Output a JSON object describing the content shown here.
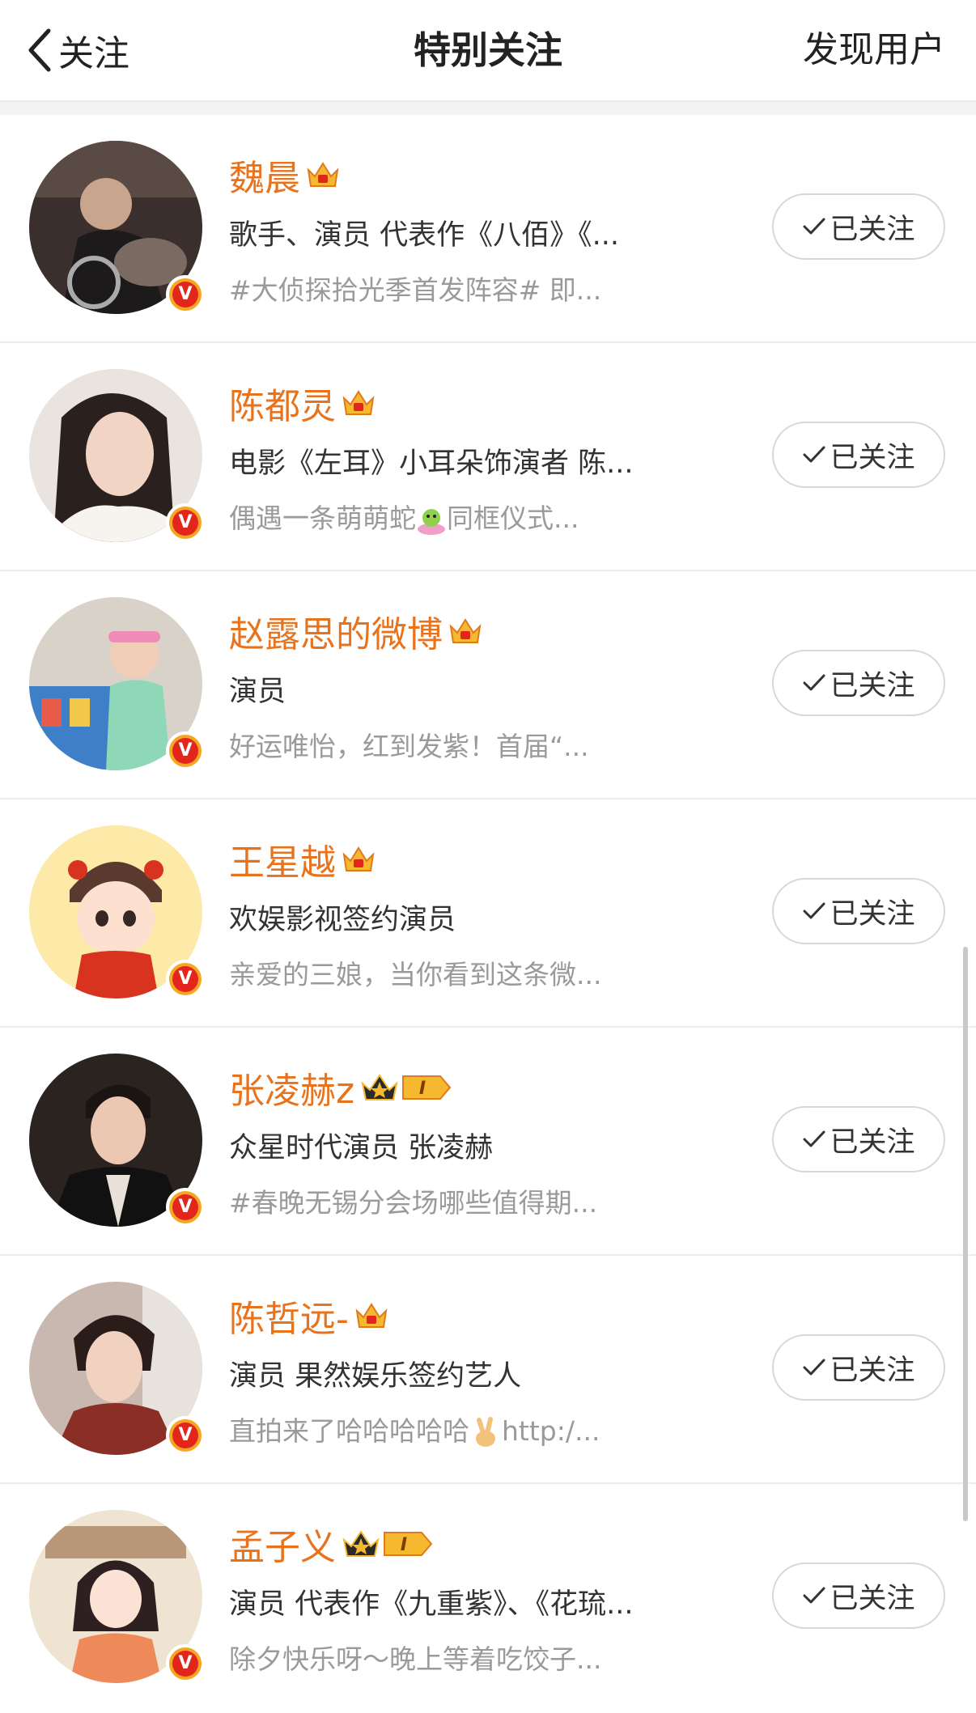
{
  "header": {
    "back_label": "关注",
    "title": "特别关注",
    "discover_label": "发现用户"
  },
  "colors": {
    "name": "#e8731c",
    "vip_badge": "#e3261c",
    "crown_gold": "#f5b82e"
  },
  "follow_label": "已关注",
  "users": [
    {
      "name": "魏晨",
      "badge": "crown-icon",
      "level": "",
      "desc": "歌手、演员 代表作《八佰》《...",
      "post": "#大侦探拾光季首发阵容# 即..."
    },
    {
      "name": "陈都灵",
      "badge": "crown-icon",
      "level": "",
      "desc": "电影《左耳》小耳朵饰演者 陈...",
      "post_before": "偶遇一条萌萌蛇",
      "post_emoji": "snake-emoji",
      "post_after": "同框仪式..."
    },
    {
      "name": "赵露思的微博",
      "badge": "crown-icon",
      "level": "",
      "desc": "演员",
      "post": "好运唯怡，红到发紫！首届“..."
    },
    {
      "name": "王星越",
      "badge": "crown-icon",
      "level": "",
      "desc": "欢娱影视签约演员",
      "post": "亲爱的三娘，当你看到这条微..."
    },
    {
      "name": "张凌赫z",
      "badge": "level-crown-icon",
      "level": "I",
      "desc": "众星时代演员 张凌赫",
      "post": "#春晚无锡分会场哪些值得期..."
    },
    {
      "name": "陈哲远-",
      "badge": "crown-icon",
      "level": "",
      "desc": "演员 果然娱乐签约艺人",
      "post_before": "直拍来了哈哈哈哈哈",
      "post_emoji": "victory-hand-emoji",
      "post_after": "http:/..."
    },
    {
      "name": "孟子义",
      "badge": "level-crown-icon",
      "level": "I",
      "desc": "演员 代表作《九重紫》、《花琉...",
      "post": "除夕快乐呀～晚上等着吃饺子..."
    }
  ]
}
